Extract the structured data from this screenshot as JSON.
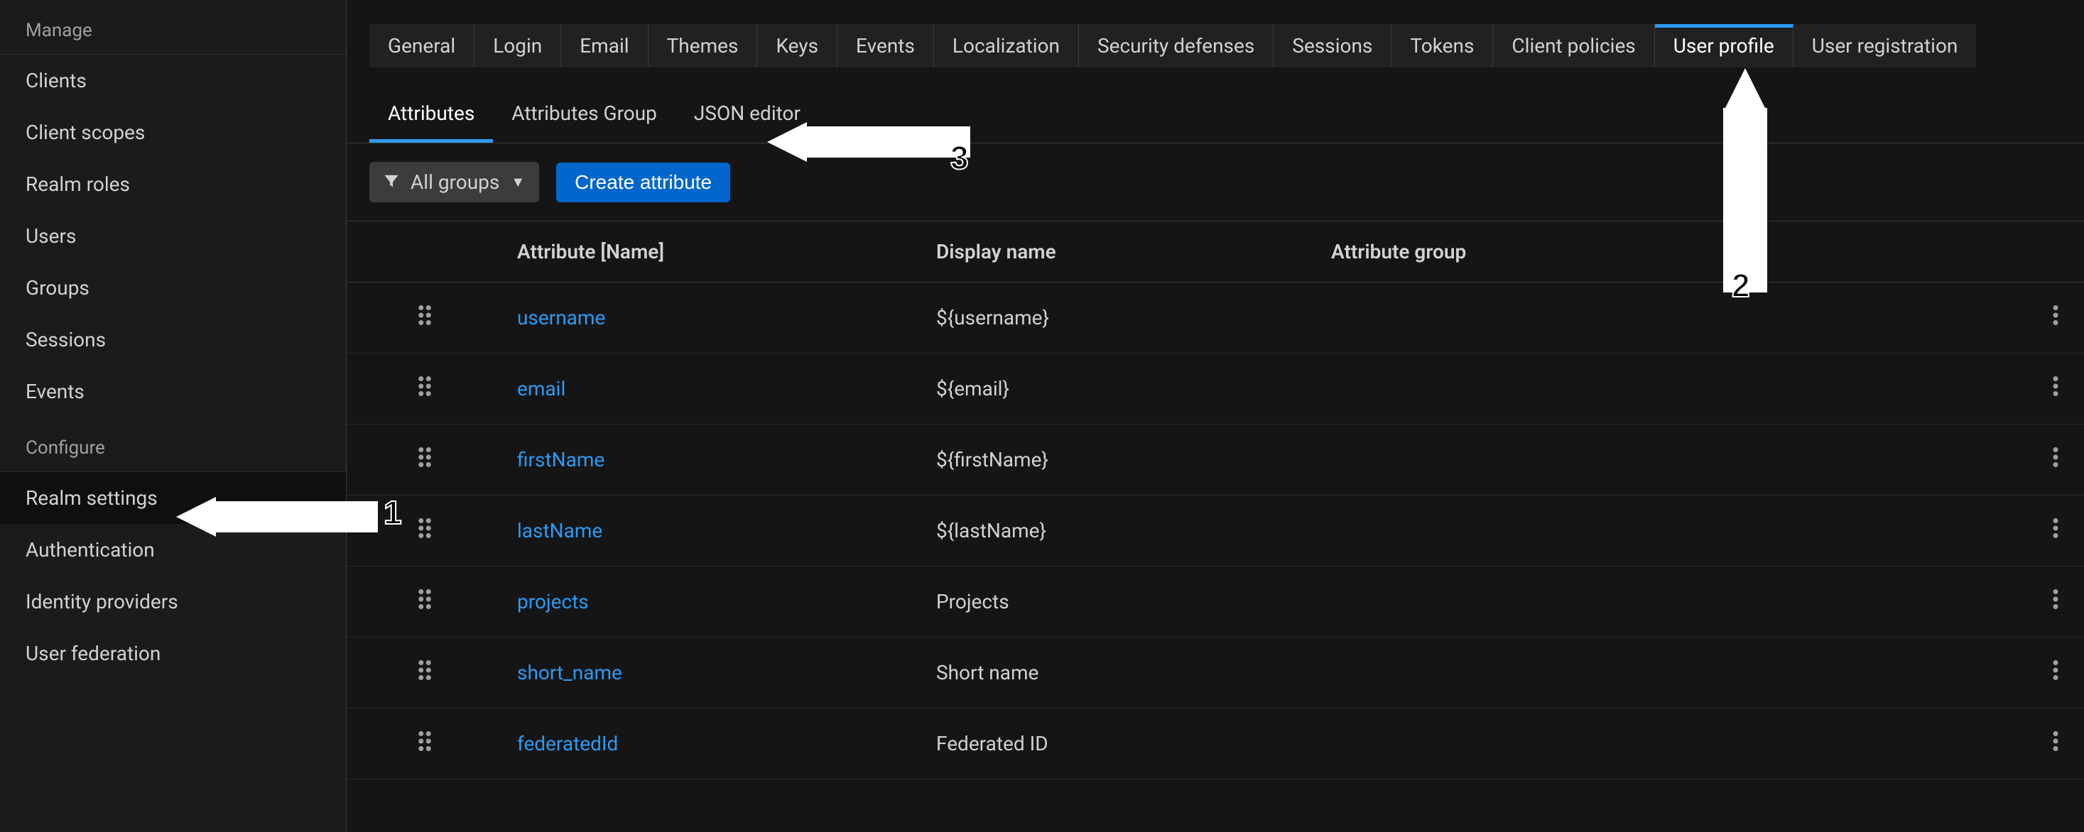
{
  "sidebar": {
    "manage_label": "Manage",
    "configure_label": "Configure",
    "manage_items": [
      {
        "label": "Clients"
      },
      {
        "label": "Client scopes"
      },
      {
        "label": "Realm roles"
      },
      {
        "label": "Users"
      },
      {
        "label": "Groups"
      },
      {
        "label": "Sessions"
      },
      {
        "label": "Events"
      }
    ],
    "configure_items": [
      {
        "label": "Realm settings",
        "active": true
      },
      {
        "label": "Authentication"
      },
      {
        "label": "Identity providers"
      },
      {
        "label": "User federation"
      }
    ]
  },
  "tabs": [
    {
      "label": "General"
    },
    {
      "label": "Login"
    },
    {
      "label": "Email"
    },
    {
      "label": "Themes"
    },
    {
      "label": "Keys"
    },
    {
      "label": "Events"
    },
    {
      "label": "Localization"
    },
    {
      "label": "Security defenses"
    },
    {
      "label": "Sessions"
    },
    {
      "label": "Tokens"
    },
    {
      "label": "Client policies"
    },
    {
      "label": "User profile",
      "active": true
    },
    {
      "label": "User registration"
    }
  ],
  "subtabs": [
    {
      "label": "Attributes",
      "active": true
    },
    {
      "label": "Attributes Group"
    },
    {
      "label": "JSON editor"
    }
  ],
  "toolbar": {
    "filter_label": "All groups",
    "create_label": "Create attribute"
  },
  "columns": {
    "name": "Attribute [Name]",
    "display": "Display name",
    "group": "Attribute group"
  },
  "rows": [
    {
      "name": "username",
      "display": "${username}",
      "group": ""
    },
    {
      "name": "email",
      "display": "${email}",
      "group": ""
    },
    {
      "name": "firstName",
      "display": "${firstName}",
      "group": ""
    },
    {
      "name": "lastName",
      "display": "${lastName}",
      "group": ""
    },
    {
      "name": "projects",
      "display": "Projects",
      "group": ""
    },
    {
      "name": "short_name",
      "display": "Short name",
      "group": ""
    },
    {
      "name": "federatedId",
      "display": "Federated ID",
      "group": ""
    }
  ],
  "annotations": {
    "n1": "1",
    "n2": "2",
    "n3": "3"
  }
}
